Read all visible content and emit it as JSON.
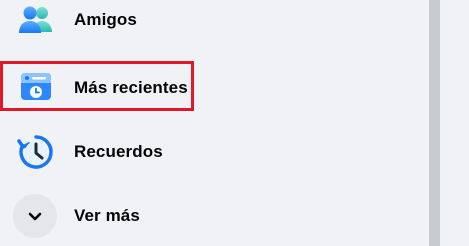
{
  "sidebar": {
    "items": [
      {
        "label": "Amigos",
        "icon": "friends-icon"
      },
      {
        "label": "Más recientes",
        "icon": "most-recent-icon"
      },
      {
        "label": "Recuerdos",
        "icon": "memories-icon"
      },
      {
        "label": "Ver más",
        "icon": "chevron-down-icon"
      }
    ]
  },
  "colors": {
    "highlight_border": "#e0192a",
    "accent_blue": "#1877f2",
    "background": "#f0f2f5"
  }
}
